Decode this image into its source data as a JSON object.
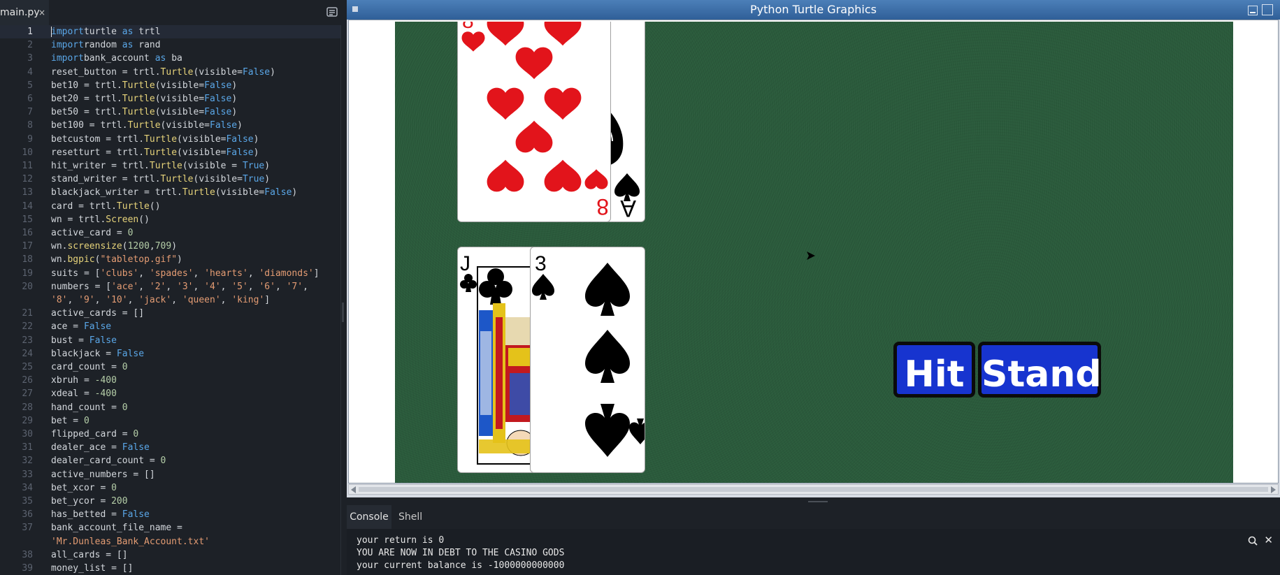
{
  "editor": {
    "tab_name": "main.py",
    "tab_close": "×",
    "active_line": 1,
    "lines": [
      {
        "n": "1",
        "t": [
          [
            "kw",
            "import"
          ],
          [
            "",
            "turtle "
          ],
          [
            "kw",
            "as"
          ],
          [
            "",
            " trtl"
          ]
        ]
      },
      {
        "n": "2",
        "t": [
          [
            "kw",
            "import"
          ],
          [
            "",
            "random "
          ],
          [
            "kw",
            "as"
          ],
          [
            "",
            " rand"
          ]
        ]
      },
      {
        "n": "3",
        "t": [
          [
            "kw",
            "import"
          ],
          [
            "",
            "bank_account "
          ],
          [
            "kw",
            "as"
          ],
          [
            "",
            " ba"
          ]
        ]
      },
      {
        "n": "4",
        "t": [
          [
            "",
            "reset_button = trtl."
          ],
          [
            "fn",
            "Turtle"
          ],
          [
            "",
            "(visible="
          ],
          [
            "bool",
            "False"
          ],
          [
            "",
            ")"
          ]
        ]
      },
      {
        "n": "5",
        "t": [
          [
            "",
            "bet10 = trtl."
          ],
          [
            "fn",
            "Turtle"
          ],
          [
            "",
            "(visible="
          ],
          [
            "bool",
            "False"
          ],
          [
            "",
            ")"
          ]
        ]
      },
      {
        "n": "6",
        "t": [
          [
            "",
            "bet20 = trtl."
          ],
          [
            "fn",
            "Turtle"
          ],
          [
            "",
            "(visible="
          ],
          [
            "bool",
            "False"
          ],
          [
            "",
            ")"
          ]
        ]
      },
      {
        "n": "7",
        "t": [
          [
            "",
            "bet50 = trtl."
          ],
          [
            "fn",
            "Turtle"
          ],
          [
            "",
            "(visible="
          ],
          [
            "bool",
            "False"
          ],
          [
            "",
            ")"
          ]
        ]
      },
      {
        "n": "8",
        "t": [
          [
            "",
            "bet100 = trtl."
          ],
          [
            "fn",
            "Turtle"
          ],
          [
            "",
            "(visible="
          ],
          [
            "bool",
            "False"
          ],
          [
            "",
            ")"
          ]
        ]
      },
      {
        "n": "9",
        "t": [
          [
            "",
            "betcustom = trtl."
          ],
          [
            "fn",
            "Turtle"
          ],
          [
            "",
            "(visible="
          ],
          [
            "bool",
            "False"
          ],
          [
            "",
            ")"
          ]
        ]
      },
      {
        "n": "10",
        "t": [
          [
            "",
            "resetturt = trtl."
          ],
          [
            "fn",
            "Turtle"
          ],
          [
            "",
            "(visible="
          ],
          [
            "bool",
            "False"
          ],
          [
            "",
            ")"
          ]
        ]
      },
      {
        "n": "11",
        "t": [
          [
            "",
            "hit_writer = trtl."
          ],
          [
            "fn",
            "Turtle"
          ],
          [
            "",
            "(visible = "
          ],
          [
            "bool",
            "True"
          ],
          [
            "",
            ")"
          ]
        ]
      },
      {
        "n": "12",
        "t": [
          [
            "",
            "stand_writer = trtl."
          ],
          [
            "fn",
            "Turtle"
          ],
          [
            "",
            "(visible="
          ],
          [
            "bool",
            "True"
          ],
          [
            "",
            ")"
          ]
        ]
      },
      {
        "n": "13",
        "t": [
          [
            "",
            "blackjack_writer = trtl."
          ],
          [
            "fn",
            "Turtle"
          ],
          [
            "",
            "(visible="
          ],
          [
            "bool",
            "False"
          ],
          [
            "",
            ")"
          ]
        ]
      },
      {
        "n": "14",
        "t": [
          [
            "",
            "card = trtl."
          ],
          [
            "fn",
            "Turtle"
          ],
          [
            "",
            "()"
          ]
        ]
      },
      {
        "n": "15",
        "t": [
          [
            "",
            "wn = trtl."
          ],
          [
            "fn",
            "Screen"
          ],
          [
            "",
            "()"
          ]
        ]
      },
      {
        "n": "16",
        "t": [
          [
            "",
            "active_card = "
          ],
          [
            "num",
            "0"
          ]
        ]
      },
      {
        "n": "17",
        "t": [
          [
            "",
            "wn."
          ],
          [
            "fn",
            "screensize"
          ],
          [
            "",
            "("
          ],
          [
            "num",
            "1200"
          ],
          [
            "",
            ","
          ],
          [
            "num",
            "709"
          ],
          [
            "",
            ")"
          ]
        ]
      },
      {
        "n": "18",
        "t": [
          [
            "",
            "wn."
          ],
          [
            "fn",
            "bgpic"
          ],
          [
            "",
            "("
          ],
          [
            "str",
            "\"tabletop.gif\""
          ],
          [
            "",
            ")"
          ]
        ]
      },
      {
        "n": "19",
        "t": [
          [
            "",
            "suits = ["
          ],
          [
            "str",
            "'clubs'"
          ],
          [
            "",
            ", "
          ],
          [
            "str",
            "'spades'"
          ],
          [
            "",
            ", "
          ],
          [
            "str",
            "'hearts'"
          ],
          [
            "",
            ", "
          ],
          [
            "str",
            "'diamonds'"
          ],
          [
            "",
            "]"
          ]
        ]
      },
      {
        "n": "20",
        "t": [
          [
            "",
            "numbers = ["
          ],
          [
            "str",
            "'ace'"
          ],
          [
            "",
            ", "
          ],
          [
            "str",
            "'2'"
          ],
          [
            "",
            ", "
          ],
          [
            "str",
            "'3'"
          ],
          [
            "",
            ", "
          ],
          [
            "str",
            "'4'"
          ],
          [
            "",
            ", "
          ],
          [
            "str",
            "'5'"
          ],
          [
            "",
            ", "
          ],
          [
            "str",
            "'6'"
          ],
          [
            "",
            ", "
          ],
          [
            "str",
            "'7'"
          ],
          [
            "",
            ","
          ]
        ]
      },
      {
        "n": "",
        "t": [
          [
            "str",
            "'8'"
          ],
          [
            "",
            ", "
          ],
          [
            "str",
            "'9'"
          ],
          [
            "",
            ", "
          ],
          [
            "str",
            "'10'"
          ],
          [
            "",
            ", "
          ],
          [
            "str",
            "'jack'"
          ],
          [
            "",
            ", "
          ],
          [
            "str",
            "'queen'"
          ],
          [
            "",
            ", "
          ],
          [
            "str",
            "'king'"
          ],
          [
            "",
            "]"
          ]
        ]
      },
      {
        "n": "21",
        "t": [
          [
            "",
            "active_cards = []"
          ]
        ]
      },
      {
        "n": "22",
        "t": [
          [
            "",
            "ace = "
          ],
          [
            "bool",
            "False"
          ]
        ]
      },
      {
        "n": "23",
        "t": [
          [
            "",
            "bust = "
          ],
          [
            "bool",
            "False"
          ]
        ]
      },
      {
        "n": "24",
        "t": [
          [
            "",
            "blackjack = "
          ],
          [
            "bool",
            "False"
          ]
        ]
      },
      {
        "n": "25",
        "t": [
          [
            "",
            "card_count = "
          ],
          [
            "num",
            "0"
          ]
        ]
      },
      {
        "n": "26",
        "t": [
          [
            "",
            "xbruh = "
          ],
          [
            "num",
            "-400"
          ]
        ]
      },
      {
        "n": "27",
        "t": [
          [
            "",
            "xdeal = "
          ],
          [
            "num",
            "-400"
          ]
        ]
      },
      {
        "n": "28",
        "t": [
          [
            "",
            "hand_count = "
          ],
          [
            "num",
            "0"
          ]
        ]
      },
      {
        "n": "29",
        "t": [
          [
            "",
            "bet = "
          ],
          [
            "num",
            "0"
          ]
        ]
      },
      {
        "n": "30",
        "t": [
          [
            "",
            "flipped_card = "
          ],
          [
            "num",
            "0"
          ]
        ]
      },
      {
        "n": "31",
        "t": [
          [
            "",
            "dealer_ace = "
          ],
          [
            "bool",
            "False"
          ]
        ]
      },
      {
        "n": "32",
        "t": [
          [
            "",
            "dealer_card_count = "
          ],
          [
            "num",
            "0"
          ]
        ]
      },
      {
        "n": "33",
        "t": [
          [
            "",
            "active_numbers = []"
          ]
        ]
      },
      {
        "n": "34",
        "t": [
          [
            "",
            "bet_xcor = "
          ],
          [
            "num",
            "0"
          ]
        ]
      },
      {
        "n": "35",
        "t": [
          [
            "",
            "bet_ycor = "
          ],
          [
            "num",
            "200"
          ]
        ]
      },
      {
        "n": "36",
        "t": [
          [
            "",
            "has_betted = "
          ],
          [
            "bool",
            "False"
          ]
        ]
      },
      {
        "n": "37",
        "t": [
          [
            "",
            "bank_account_file_name ="
          ]
        ]
      },
      {
        "n": "",
        "t": [
          [
            "str",
            "'Mr.Dunleas_Bank_Account.txt'"
          ]
        ]
      },
      {
        "n": "38",
        "t": [
          [
            "",
            "all_cards = []"
          ]
        ]
      },
      {
        "n": "39",
        "t": [
          [
            "",
            "money_list = []"
          ]
        ]
      },
      {
        "n": "40",
        "t": []
      }
    ]
  },
  "turtle_window": {
    "title": "Python Turtle Graphics",
    "felt_color": "#2a5a3b",
    "dealer_cards": [
      {
        "rank": "8",
        "suit": "hearts",
        "color": "#e2141b"
      },
      {
        "rank": "A",
        "suit": "spades",
        "color": "#000000"
      }
    ],
    "player_cards": [
      {
        "rank": "J",
        "suit": "clubs",
        "color": "#000000"
      },
      {
        "rank": "3",
        "suit": "spades",
        "color": "#000000"
      }
    ],
    "hit_label": "Hit",
    "stand_label": "Stand",
    "button_color": "#1734cf"
  },
  "bottom_panel": {
    "tabs": [
      "Console",
      "Shell"
    ],
    "active_tab": "Console",
    "console_lines": [
      "your return is 0",
      "YOU ARE NOW IN DEBT TO THE CASINO GODS",
      "your current balance is -1000000000000"
    ]
  }
}
